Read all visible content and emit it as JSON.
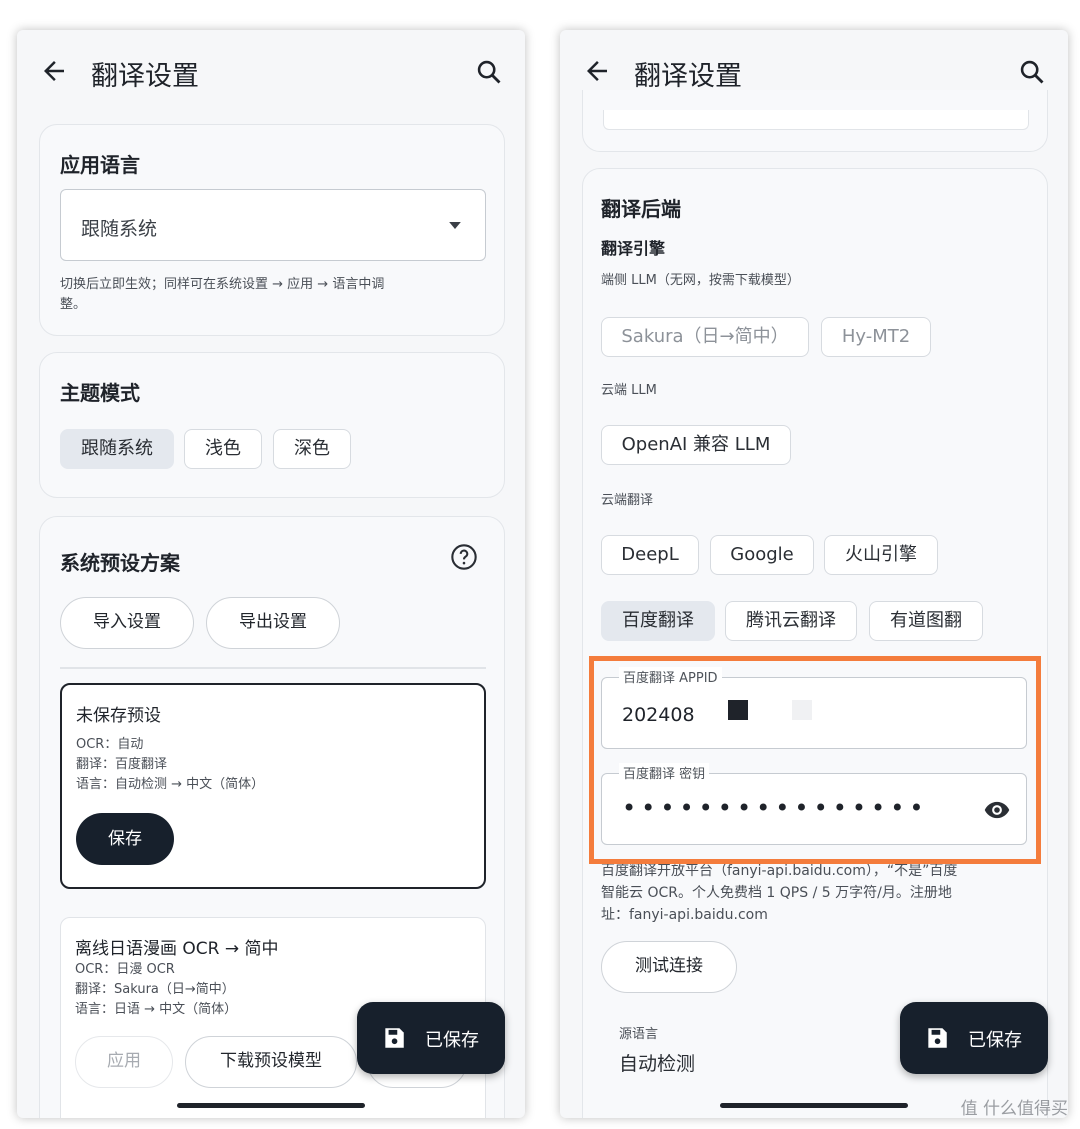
{
  "left": {
    "title": "翻译设置",
    "app_language": {
      "heading": "应用语言",
      "selected": "跟随系统",
      "hint_line1": "切换后立即生效；同样可在系统设置 → 应用 → 语言中调",
      "hint_line2": "整。"
    },
    "theme": {
      "heading": "主题模式",
      "options": [
        "跟随系统",
        "浅色",
        "深色"
      ]
    },
    "presets": {
      "heading": "系统预设方案",
      "import_label": "导入设置",
      "export_label": "导出设置",
      "unsaved": {
        "title": "未保存预设",
        "ocr": "OCR：自动",
        "translate": "翻译：百度翻译",
        "language": "语言：自动检测 → 中文（简体）",
        "save_label": "保存"
      },
      "offline": {
        "title": "离线日语漫画 OCR → 简中",
        "ocr": "OCR：日漫 OCR",
        "translate": "翻译：Sakura（日→简中）",
        "language": "语言：日语 → 中文（简体）",
        "apply_label": "应用",
        "download_label": "下载预设模型"
      }
    },
    "fab_label": "已保存"
  },
  "right": {
    "title": "翻译设置",
    "backend": {
      "heading": "翻译后端",
      "engine_heading": "翻译引擎",
      "ondevice_caption": "端侧 LLM（无网，按需下载模型）",
      "ondevice_options": [
        "Sakura（日→简中）",
        "Hy-MT2"
      ],
      "cloud_llm_caption": "云端 LLM",
      "cloud_llm_options": [
        "OpenAI 兼容 LLM"
      ],
      "cloud_mt_caption": "云端翻译",
      "cloud_mt_row1": [
        "DeepL",
        "Google",
        "火山引擎"
      ],
      "cloud_mt_row2": [
        "百度翻译",
        "腾讯云翻译",
        "有道图翻"
      ],
      "appid_label": "百度翻译 APPID",
      "appid_value": "202408",
      "secret_label": "百度翻译 密钥",
      "secret_value": "••••••••••••••••",
      "note_line1": "百度翻译开放平台（fanyi-api.baidu.com），“不是”百度",
      "note_line2": "智能云 OCR。个人免费档 1 QPS / 5 万字符/月。注册地",
      "note_line3": "址：fanyi-api.baidu.com",
      "test_label": "测试连接",
      "source_lang_label": "源语言",
      "source_lang_value": "自动检测"
    },
    "fab_label": "已保存"
  },
  "watermark": "值 什么值得买",
  "colors": {
    "highlight": "#f47c3c",
    "fab": "#17202c",
    "selected_chip": "#e4e8ee"
  }
}
